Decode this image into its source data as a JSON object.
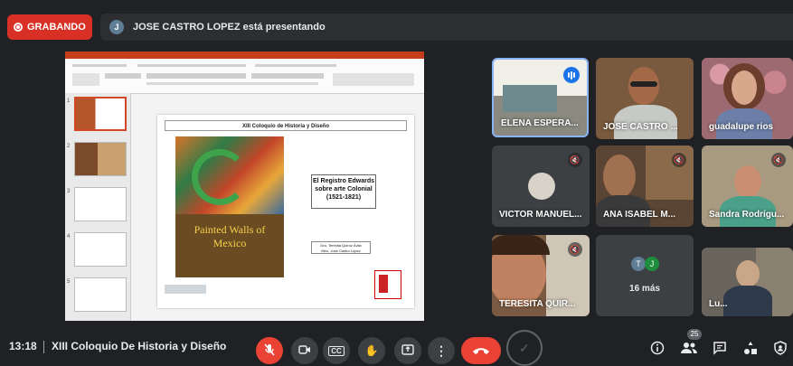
{
  "recording": {
    "label": "GRABANDO",
    "color": "#d93025"
  },
  "presenting": {
    "avatar_initial": "J",
    "text": "JOSE CASTRO LOPEZ está presentando"
  },
  "slide": {
    "header": "XIII Coloquio de Historia y Diseño",
    "book_title": "Painted Walls of Mexico",
    "box_lines": [
      "El Registro Edwards",
      "sobre arte Colonial",
      "(1521-1821)"
    ],
    "authors": [
      "Dra. Teresita Quiroz Ávila",
      "Mtro. José Castro López"
    ]
  },
  "participants": [
    {
      "name": "ELENA ESPERA...",
      "muted": false,
      "speaking": true
    },
    {
      "name": "JOSE CASTRO ...",
      "muted": false,
      "speaking": false
    },
    {
      "name": "guadalupe rios",
      "muted": false,
      "speaking": false
    },
    {
      "name": "VICTOR MANUEL...",
      "muted": true,
      "speaking": false
    },
    {
      "name": "ANA ISABEL M...",
      "muted": true,
      "speaking": false
    },
    {
      "name": "Sandra Rodrígu...",
      "muted": true,
      "speaking": false
    },
    {
      "name": "TERESITA QUIR...",
      "muted": true,
      "speaking": false
    },
    {
      "name": "Lu...",
      "muted": false,
      "speaking": false
    }
  ],
  "more": {
    "avatars": [
      "T",
      "J"
    ],
    "label": "16 más"
  },
  "bottom": {
    "time": "13:18",
    "separator": "|",
    "meeting_title": "XIII Coloquio De Historia y Diseño",
    "participant_count": "25"
  },
  "icons": [
    "mic-off-icon",
    "camera-icon",
    "captions-icon",
    "raise-hand-icon",
    "present-icon",
    "more-options-icon",
    "end-call-icon",
    "info-icon",
    "people-icon",
    "chat-icon",
    "activities-icon",
    "host-controls-icon"
  ],
  "colors": {
    "background": "#202124",
    "accent_red": "#ea4335",
    "speaking_blue": "#1a73e8"
  }
}
